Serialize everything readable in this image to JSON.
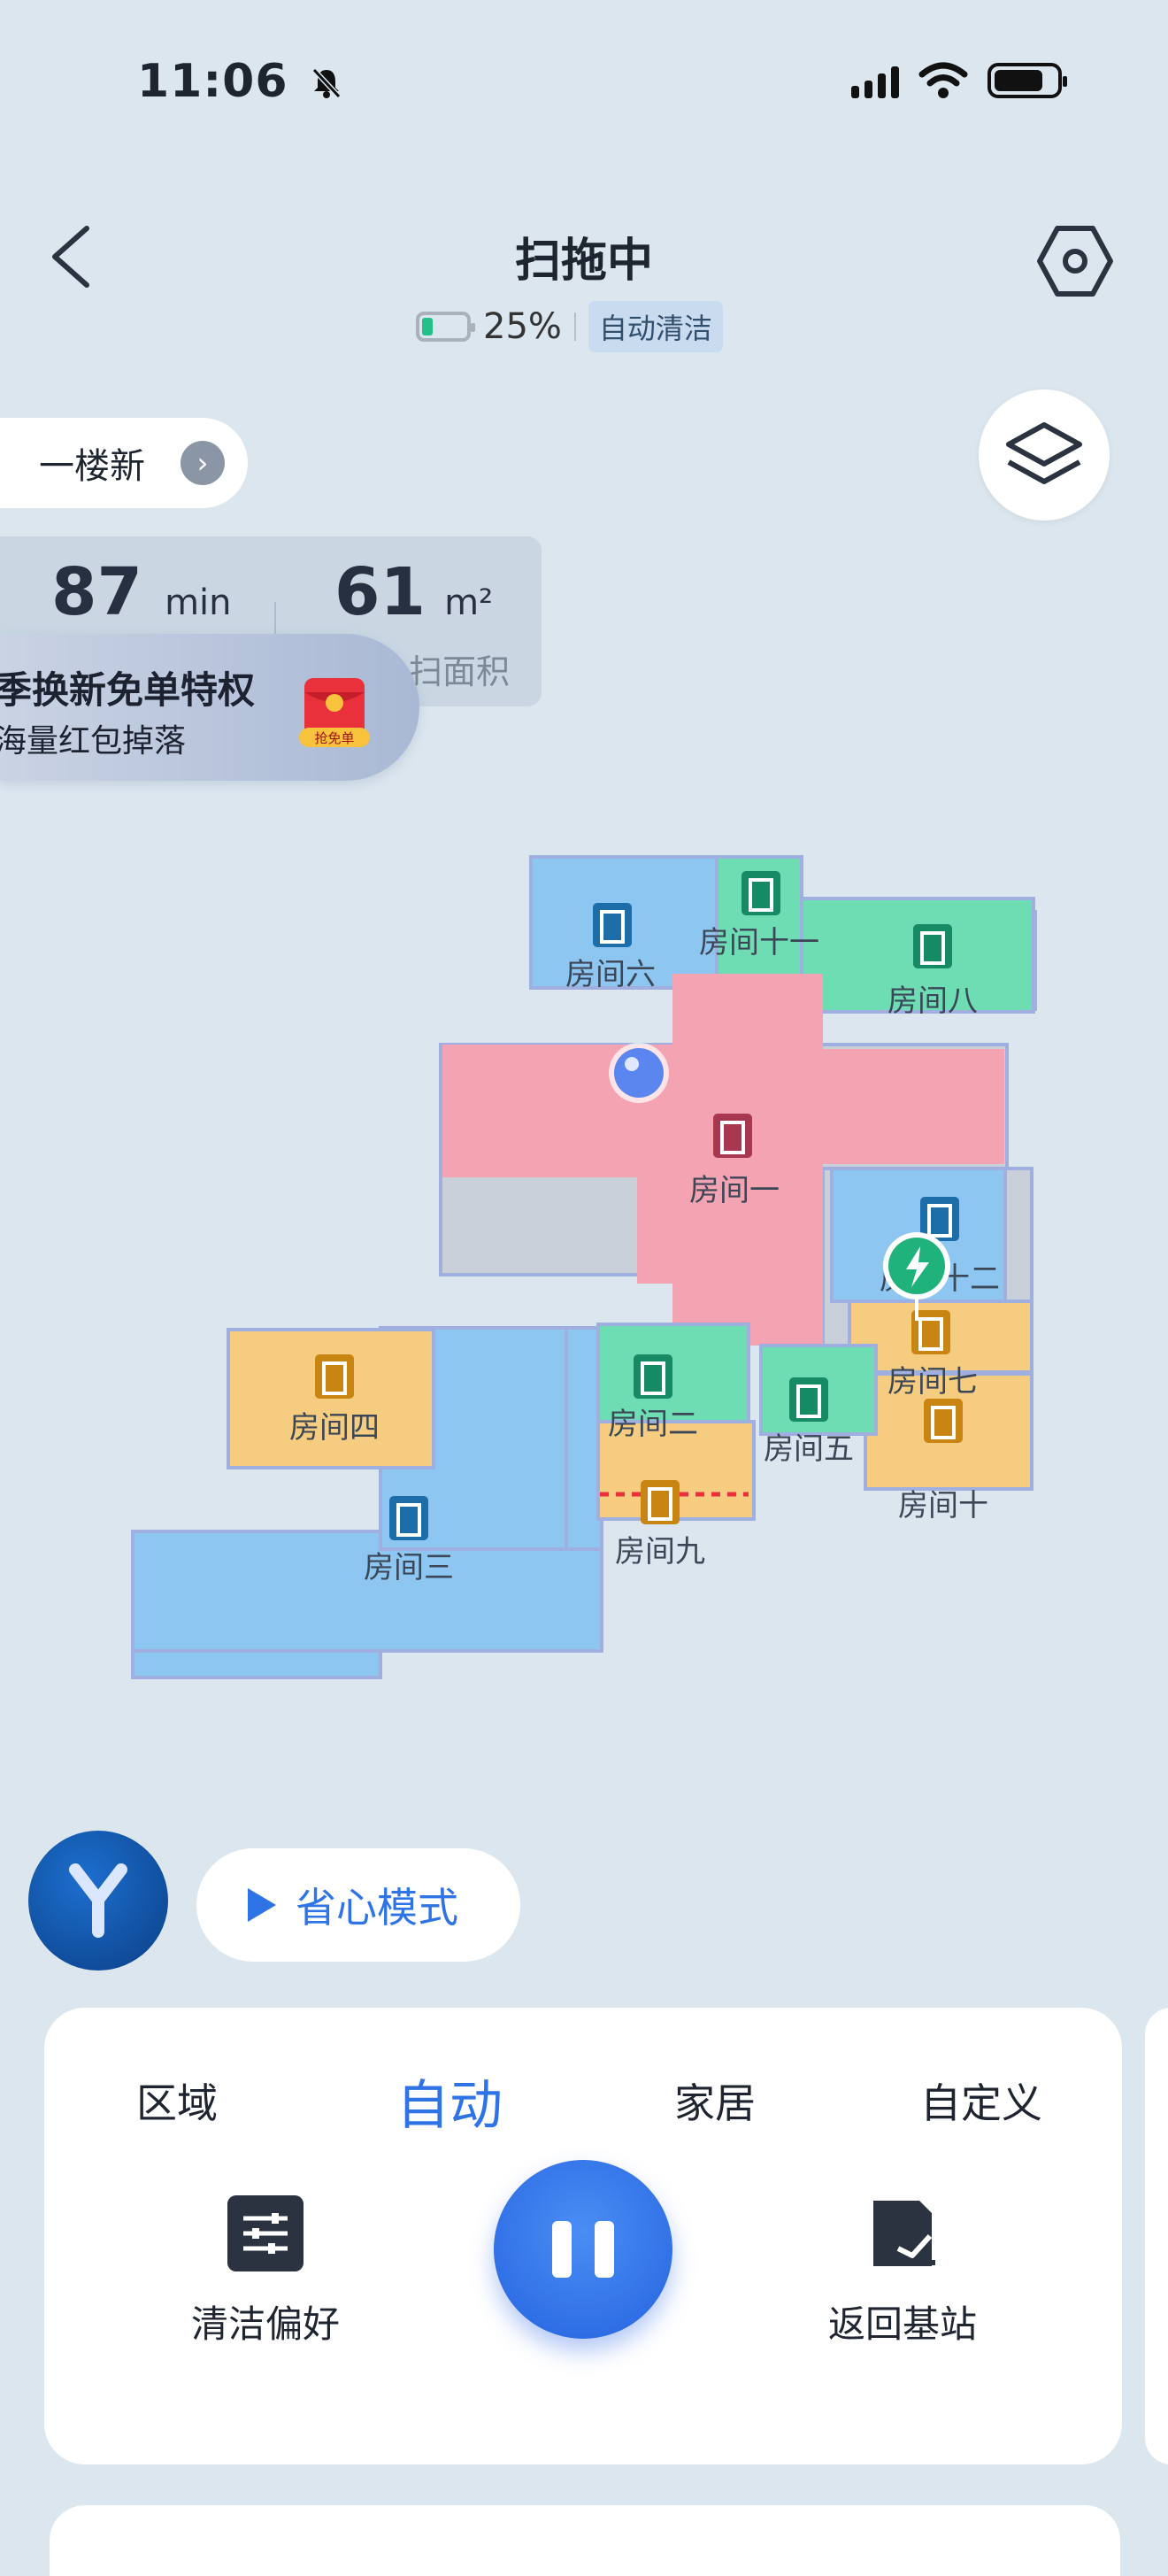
{
  "status_bar": {
    "time": "11:06"
  },
  "header": {
    "title": "扫拖中",
    "battery_percent": "25%",
    "battery_level": 0.25,
    "mode_tag": "自动清洁"
  },
  "floor": {
    "name": "一楼新"
  },
  "stats": {
    "time_value": "87",
    "time_unit": "min",
    "area_value": "61",
    "area_unit": "m²",
    "area_label_partial": "扫面积"
  },
  "promo": {
    "line1": "季换新免单特权",
    "line2": "海量红包掉落",
    "badge": "抢免单"
  },
  "map": {
    "rooms": [
      {
        "name": "房间一",
        "color": "#f4a3b2"
      },
      {
        "name": "房间二",
        "color": "#6fddb4"
      },
      {
        "name": "房间三",
        "color": "#8ec6f2"
      },
      {
        "name": "房间四",
        "color": "#f6cd80"
      },
      {
        "name": "房间五",
        "color": "#6fddb4"
      },
      {
        "name": "房间六",
        "color": "#8ec6f2"
      },
      {
        "name": "房间七",
        "color": "#f6cd80"
      },
      {
        "name": "房间八",
        "color": "#6fddb4"
      },
      {
        "name": "房间九",
        "color": "#f6cd80"
      },
      {
        "name": "房间十",
        "color": "#f6cd80"
      },
      {
        "name": "房间十一",
        "color": "#6fddb4"
      },
      {
        "name": "房间十二",
        "color": "#8ec6f2"
      }
    ]
  },
  "controls": {
    "mode_button": "省心模式",
    "tabs": [
      "区域",
      "自动",
      "家居",
      "自定义"
    ],
    "active_tab": "自动",
    "left_action": "清洁偏好",
    "right_action": "返回基站"
  },
  "colors": {
    "accent": "#2f74e6",
    "background": "#dbe6ef"
  }
}
